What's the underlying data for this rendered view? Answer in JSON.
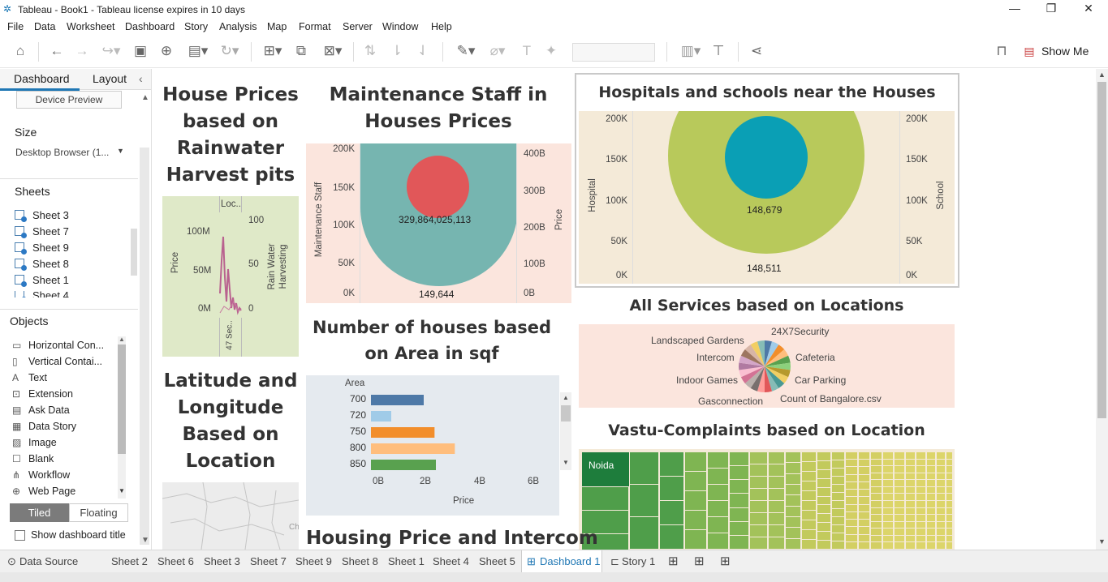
{
  "window": {
    "title": "Tableau - Book1 - Tableau license expires in 10 days"
  },
  "menu": [
    "File",
    "Data",
    "Worksheet",
    "Dashboard",
    "Story",
    "Analysis",
    "Map",
    "Format",
    "Server",
    "Window",
    "Help"
  ],
  "toolbar": {
    "show_me": "Show Me"
  },
  "left_panel": {
    "tabs": [
      "Dashboard",
      "Layout"
    ],
    "device_preview": "Device Preview",
    "size_heading": "Size",
    "size_value": "Desktop Browser (1...",
    "sheets_heading": "Sheets",
    "sheets": [
      "Sheet 3",
      "Sheet 7",
      "Sheet 9",
      "Sheet 8",
      "Sheet 1",
      "Sheet 4"
    ],
    "objects_heading": "Objects",
    "objects": [
      {
        "label": "Horizontal Con...",
        "icon": "horizontal-container-icon"
      },
      {
        "label": "Vertical Contai...",
        "icon": "vertical-container-icon"
      },
      {
        "label": "Text",
        "icon": "text-icon"
      },
      {
        "label": "Extension",
        "icon": "extension-icon"
      },
      {
        "label": "Ask Data",
        "icon": "ask-data-icon"
      },
      {
        "label": "Data Story",
        "icon": "data-story-icon"
      },
      {
        "label": "Image",
        "icon": "image-icon"
      },
      {
        "label": "Blank",
        "icon": "blank-icon"
      },
      {
        "label": "Workflow",
        "icon": "workflow-icon"
      },
      {
        "label": "Web Page",
        "icon": "web-page-icon"
      }
    ],
    "tiled": "Tiled",
    "floating": "Floating",
    "show_title": "Show dashboard title"
  },
  "dashboard": {
    "rainwater": {
      "title": "House Prices based on Rainwater Harvest pits",
      "col_header": "Loc..",
      "ylabel": "Price",
      "y2label": "Rain Water Harvesting",
      "yticks": [
        "100M",
        "50M",
        "0M"
      ],
      "y2ticks": [
        "100",
        "50",
        "0"
      ],
      "bottom_label": "47 Sec.."
    },
    "maintenance": {
      "title": "Maintenance Staff in Houses Prices",
      "ylabel": "Maintenance Staff",
      "y2label": "Price",
      "yticks": [
        "200K",
        "150K",
        "100K",
        "50K",
        "0K"
      ],
      "y2ticks": [
        "400B",
        "300B",
        "200B",
        "100B",
        "0B"
      ],
      "inner_label": "329,864,025,113",
      "outer_label": "149,644"
    },
    "hospitals": {
      "title": "Hospitals and schools near the Houses",
      "ylabel": "Hospital",
      "y2label": "School",
      "yticks": [
        "200K",
        "150K",
        "100K",
        "50K",
        "0K"
      ],
      "y2ticks": [
        "200K",
        "150K",
        "100K",
        "50K",
        "0K"
      ],
      "inner_label": "148,679",
      "outer_label": "148,511"
    },
    "area": {
      "title": "Number of houses based on Area in sqf",
      "header": "Area",
      "xlabel": "Price",
      "xticks": [
        "0B",
        "2B",
        "4B",
        "6B"
      ]
    },
    "latlong": {
      "title": "Latitude and Longitude Based on Location",
      "map_label": "Ch"
    },
    "services": {
      "title": "All Services based on Locations",
      "labels": [
        "Landscaped Gardens",
        "24X7Security",
        "Intercom",
        "Cafeteria",
        "Indoor Games",
        "Car Parking",
        "Gasconnection",
        "Count of Bangalore.csv"
      ]
    },
    "vastu": {
      "title": "Vastu-Complaints based on Location",
      "label": "Noida"
    },
    "intercom": {
      "title": "Housing Price and Intercom"
    }
  },
  "chart_data": [
    {
      "type": "bar",
      "title": "Number of houses based on Area in sqf",
      "xlabel": "Price",
      "ylabel": "Area",
      "categories": [
        "700",
        "720",
        "750",
        "800",
        "850"
      ],
      "values": [
        1.95,
        0.75,
        2.35,
        3.1,
        2.4
      ],
      "xlim": [
        0,
        7
      ],
      "colors": [
        "#4e79a7",
        "#a0cbe8",
        "#f28e2b",
        "#ffbe7d",
        "#59a14f"
      ]
    },
    {
      "type": "pie",
      "title": "All Services based on Locations",
      "values": [
        1,
        1,
        1,
        1,
        1,
        1,
        1,
        1,
        1,
        1,
        1,
        1,
        1,
        1,
        1,
        1,
        1,
        1,
        1,
        1,
        1,
        1
      ],
      "colors": [
        "#4e79a7",
        "#a0cbe8",
        "#f28e2b",
        "#ffbe7d",
        "#59a14f",
        "#8cd17d",
        "#b6992d",
        "#f1ce63",
        "#499894",
        "#86bcb6",
        "#e15759",
        "#ff9d9a",
        "#79706e",
        "#bab0ac",
        "#d37295",
        "#fabfd2",
        "#b07aa1",
        "#d4a6c8",
        "#9d7660",
        "#d7b5a6",
        "#f1ce63",
        "#86bcb6"
      ]
    }
  ],
  "tabs": [
    "Data Source",
    "Sheet 2",
    "Sheet 6",
    "Sheet 3",
    "Sheet 7",
    "Sheet 9",
    "Sheet 8",
    "Sheet 1",
    "Sheet 4",
    "Sheet 5",
    "Dashboard 1",
    "Story 1"
  ],
  "colors": {
    "accent": "#1f77b4",
    "teal": "#76b5b0",
    "red": "#e15759",
    "lime": "#b8c95b",
    "cyan": "#0a9fb5",
    "peach": "#fbe5dd",
    "beige": "#f4ead8"
  }
}
